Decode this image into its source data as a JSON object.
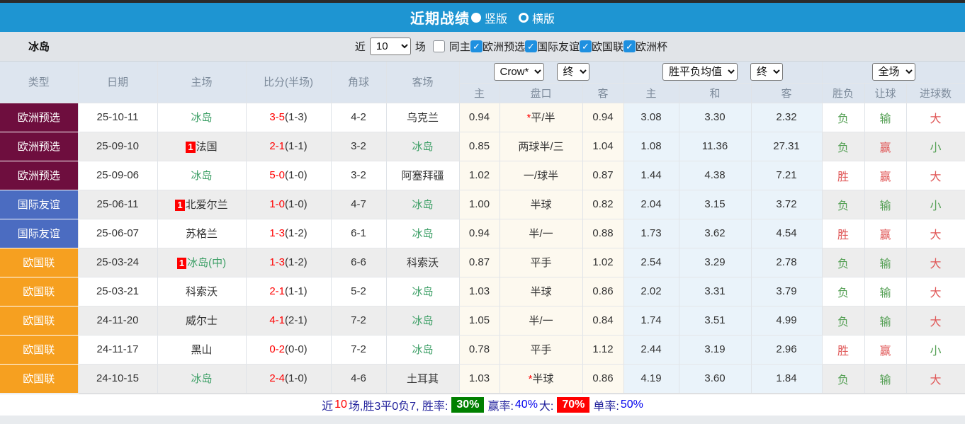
{
  "titlebar": {
    "title": "近期战绩",
    "modes": [
      {
        "label": "竖版",
        "selected": true
      },
      {
        "label": "横版",
        "selected": false
      }
    ]
  },
  "filter": {
    "team": "冰岛",
    "near_label": "近",
    "count_value": "10",
    "unit_label": "场",
    "same_home_label": "同主",
    "competitions": [
      {
        "label": "欧洲预选",
        "checked": true
      },
      {
        "label": "国际友谊",
        "checked": true
      },
      {
        "label": "欧国联",
        "checked": true
      },
      {
        "label": "欧洲杯",
        "checked": true
      }
    ]
  },
  "table": {
    "columns": {
      "type": "类型",
      "date": "日期",
      "home": "主场",
      "score": "比分(半场)",
      "corner": "角球",
      "away": "客场"
    },
    "selects": {
      "company": "Crow*",
      "company_stage": "终",
      "avg": "胜平负均值",
      "avg_stage": "终",
      "scope": "全场"
    },
    "subheaders": {
      "odds_home": "主",
      "handicap": "盘口",
      "odds_away": "客",
      "avg_home": "主",
      "avg_draw": "和",
      "avg_away": "客",
      "result": "胜负",
      "handicap_result": "让球",
      "goals": "进球数"
    },
    "type_colors": {
      "欧洲预选": "#6e0e3e",
      "国际友谊": "#4b6cc1",
      "欧国联": "#f6a020"
    },
    "rows": [
      {
        "type": "欧洲预选",
        "date": "25-10-11",
        "home": "冰岛",
        "home_self": true,
        "home_badge": false,
        "score": "3-5",
        "half": "(1-3)",
        "corners": "4-2",
        "away": "乌克兰",
        "away_self": false,
        "odds_home": "0.94",
        "handicap": "平/半",
        "handicap_star": true,
        "odds_away": "0.94",
        "avg_home": "3.08",
        "avg_draw": "3.30",
        "avg_away": "2.32",
        "result": "负",
        "result_color": "green",
        "handicap_result": "输",
        "handicap_result_color": "green",
        "goals": "大",
        "goals_color": "red"
      },
      {
        "type": "欧洲预选",
        "date": "25-09-10",
        "home": "法国",
        "home_self": false,
        "home_badge": true,
        "score": "2-1",
        "half": "(1-1)",
        "corners": "3-2",
        "away": "冰岛",
        "away_self": true,
        "odds_home": "0.85",
        "handicap": "两球半/三",
        "handicap_star": false,
        "odds_away": "1.04",
        "avg_home": "1.08",
        "avg_draw": "11.36",
        "avg_away": "27.31",
        "result": "负",
        "result_color": "green",
        "handicap_result": "赢",
        "handicap_result_color": "red",
        "goals": "小",
        "goals_color": "green"
      },
      {
        "type": "欧洲预选",
        "date": "25-09-06",
        "home": "冰岛",
        "home_self": true,
        "home_badge": false,
        "score": "5-0",
        "half": "(1-0)",
        "corners": "3-2",
        "away": "阿塞拜疆",
        "away_self": false,
        "odds_home": "1.02",
        "handicap": "一/球半",
        "handicap_star": false,
        "odds_away": "0.87",
        "avg_home": "1.44",
        "avg_draw": "4.38",
        "avg_away": "7.21",
        "result": "胜",
        "result_color": "red",
        "handicap_result": "赢",
        "handicap_result_color": "red",
        "goals": "大",
        "goals_color": "red"
      },
      {
        "type": "国际友谊",
        "date": "25-06-11",
        "home": "北爱尔兰",
        "home_self": false,
        "home_badge": true,
        "score": "1-0",
        "half": "(1-0)",
        "corners": "4-7",
        "away": "冰岛",
        "away_self": true,
        "odds_home": "1.00",
        "handicap": "半球",
        "handicap_star": false,
        "odds_away": "0.82",
        "avg_home": "2.04",
        "avg_draw": "3.15",
        "avg_away": "3.72",
        "result": "负",
        "result_color": "green",
        "handicap_result": "输",
        "handicap_result_color": "green",
        "goals": "小",
        "goals_color": "green"
      },
      {
        "type": "国际友谊",
        "date": "25-06-07",
        "home": "苏格兰",
        "home_self": false,
        "home_badge": false,
        "score": "1-3",
        "half": "(1-2)",
        "corners": "6-1",
        "away": "冰岛",
        "away_self": true,
        "odds_home": "0.94",
        "handicap": "半/一",
        "handicap_star": false,
        "odds_away": "0.88",
        "avg_home": "1.73",
        "avg_draw": "3.62",
        "avg_away": "4.54",
        "result": "胜",
        "result_color": "red",
        "handicap_result": "赢",
        "handicap_result_color": "red",
        "goals": "大",
        "goals_color": "red"
      },
      {
        "type": "欧国联",
        "date": "25-03-24",
        "home": "冰岛(中)",
        "home_self": true,
        "home_badge": true,
        "score": "1-3",
        "half": "(1-2)",
        "corners": "6-6",
        "away": "科索沃",
        "away_self": false,
        "odds_home": "0.87",
        "handicap": "平手",
        "handicap_star": false,
        "odds_away": "1.02",
        "avg_home": "2.54",
        "avg_draw": "3.29",
        "avg_away": "2.78",
        "result": "负",
        "result_color": "green",
        "handicap_result": "输",
        "handicap_result_color": "green",
        "goals": "大",
        "goals_color": "red"
      },
      {
        "type": "欧国联",
        "date": "25-03-21",
        "home": "科索沃",
        "home_self": false,
        "home_badge": false,
        "score": "2-1",
        "half": "(1-1)",
        "corners": "5-2",
        "away": "冰岛",
        "away_self": true,
        "odds_home": "1.03",
        "handicap": "半球",
        "handicap_star": false,
        "odds_away": "0.86",
        "avg_home": "2.02",
        "avg_draw": "3.31",
        "avg_away": "3.79",
        "result": "负",
        "result_color": "green",
        "handicap_result": "输",
        "handicap_result_color": "green",
        "goals": "大",
        "goals_color": "red"
      },
      {
        "type": "欧国联",
        "date": "24-11-20",
        "home": "威尔士",
        "home_self": false,
        "home_badge": false,
        "score": "4-1",
        "half": "(2-1)",
        "corners": "7-2",
        "away": "冰岛",
        "away_self": true,
        "odds_home": "1.05",
        "handicap": "半/一",
        "handicap_star": false,
        "odds_away": "0.84",
        "avg_home": "1.74",
        "avg_draw": "3.51",
        "avg_away": "4.99",
        "result": "负",
        "result_color": "green",
        "handicap_result": "输",
        "handicap_result_color": "green",
        "goals": "大",
        "goals_color": "red"
      },
      {
        "type": "欧国联",
        "date": "24-11-17",
        "home": "黑山",
        "home_self": false,
        "home_badge": false,
        "score": "0-2",
        "half": "(0-0)",
        "corners": "7-2",
        "away": "冰岛",
        "away_self": true,
        "odds_home": "0.78",
        "handicap": "平手",
        "handicap_star": false,
        "odds_away": "1.12",
        "avg_home": "2.44",
        "avg_draw": "3.19",
        "avg_away": "2.96",
        "result": "胜",
        "result_color": "red",
        "handicap_result": "赢",
        "handicap_result_color": "red",
        "goals": "小",
        "goals_color": "green"
      },
      {
        "type": "欧国联",
        "date": "24-10-15",
        "home": "冰岛",
        "home_self": true,
        "home_badge": false,
        "score": "2-4",
        "half": "(1-0)",
        "corners": "4-6",
        "away": "土耳其",
        "away_self": false,
        "odds_home": "1.03",
        "handicap": "半球",
        "handicap_star": true,
        "odds_away": "0.86",
        "avg_home": "4.19",
        "avg_draw": "3.60",
        "avg_away": "1.84",
        "result": "负",
        "result_color": "green",
        "handicap_result": "输",
        "handicap_result_color": "green",
        "goals": "大",
        "goals_color": "red"
      }
    ]
  },
  "summary": {
    "parts": [
      {
        "text": "近",
        "style": "plain"
      },
      {
        "text": "10",
        "style": "red"
      },
      {
        "text": "场,胜3平0负7, 胜率:",
        "style": "plain"
      },
      {
        "text": "30%",
        "style": "badge-green"
      },
      {
        "text": " 赢率:",
        "style": "plain"
      },
      {
        "text": "40%",
        "style": "blue"
      },
      {
        "text": " 大:",
        "style": "plain"
      },
      {
        "text": "70%",
        "style": "badge-red"
      },
      {
        "text": " 单率:",
        "style": "plain"
      },
      {
        "text": "50%",
        "style": "blue"
      }
    ]
  }
}
